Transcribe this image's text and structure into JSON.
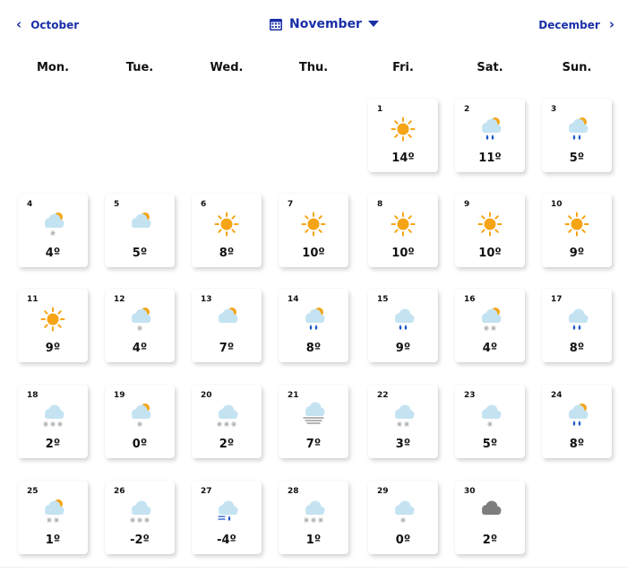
{
  "nav": {
    "prev_label": "October",
    "next_label": "December",
    "current_month": "November",
    "prev_icon": "chevron-left-icon",
    "next_icon": "chevron-right-icon",
    "calendar_icon": "calendar-icon",
    "dropdown_icon": "caret-down-icon"
  },
  "colors": {
    "accent": "#1a2fa8",
    "sun": "#f5a416",
    "cloud": "#c4e3f2",
    "rain": "#1b58c9",
    "snow": "#aaaaaa"
  },
  "weekdays": [
    "Mon.",
    "Tue.",
    "Wed.",
    "Thu.",
    "Fri.",
    "Sat.",
    "Sun."
  ],
  "days": [
    {
      "day": "1",
      "temp": "14º",
      "icon": "sun"
    },
    {
      "day": "2",
      "temp": "11º",
      "icon": "partly-rain"
    },
    {
      "day": "3",
      "temp": "5º",
      "icon": "partly-rain"
    },
    {
      "day": "4",
      "temp": "4º",
      "icon": "partly-snow"
    },
    {
      "day": "5",
      "temp": "5º",
      "icon": "partly-cloudy"
    },
    {
      "day": "6",
      "temp": "8º",
      "icon": "sun"
    },
    {
      "day": "7",
      "temp": "10º",
      "icon": "sun"
    },
    {
      "day": "8",
      "temp": "10º",
      "icon": "sun"
    },
    {
      "day": "9",
      "temp": "10º",
      "icon": "sun"
    },
    {
      "day": "10",
      "temp": "9º",
      "icon": "sun"
    },
    {
      "day": "11",
      "temp": "9º",
      "icon": "sun"
    },
    {
      "day": "12",
      "temp": "4º",
      "icon": "partly-snow"
    },
    {
      "day": "13",
      "temp": "7º",
      "icon": "partly-cloudy"
    },
    {
      "day": "14",
      "temp": "8º",
      "icon": "partly-rain"
    },
    {
      "day": "15",
      "temp": "9º",
      "icon": "cloud-rain"
    },
    {
      "day": "16",
      "temp": "4º",
      "icon": "partly-snow2"
    },
    {
      "day": "17",
      "temp": "8º",
      "icon": "cloud-rain"
    },
    {
      "day": "18",
      "temp": "2º",
      "icon": "cloud-snow3"
    },
    {
      "day": "19",
      "temp": "0º",
      "icon": "partly-snow"
    },
    {
      "day": "20",
      "temp": "2º",
      "icon": "cloud-snow3"
    },
    {
      "day": "21",
      "temp": "7º",
      "icon": "fog"
    },
    {
      "day": "22",
      "temp": "3º",
      "icon": "cloud-snow2"
    },
    {
      "day": "23",
      "temp": "5º",
      "icon": "cloud-snow"
    },
    {
      "day": "24",
      "temp": "8º",
      "icon": "partly-rain"
    },
    {
      "day": "25",
      "temp": "1º",
      "icon": "partly-snow2"
    },
    {
      "day": "26",
      "temp": "-2º",
      "icon": "cloud-snow3"
    },
    {
      "day": "27",
      "temp": "-4º",
      "icon": "fog-rain"
    },
    {
      "day": "28",
      "temp": "1º",
      "icon": "cloud-snow3"
    },
    {
      "day": "29",
      "temp": "0º",
      "icon": "cloud-snow"
    },
    {
      "day": "30",
      "temp": "2º",
      "icon": "dark-cloud"
    }
  ]
}
